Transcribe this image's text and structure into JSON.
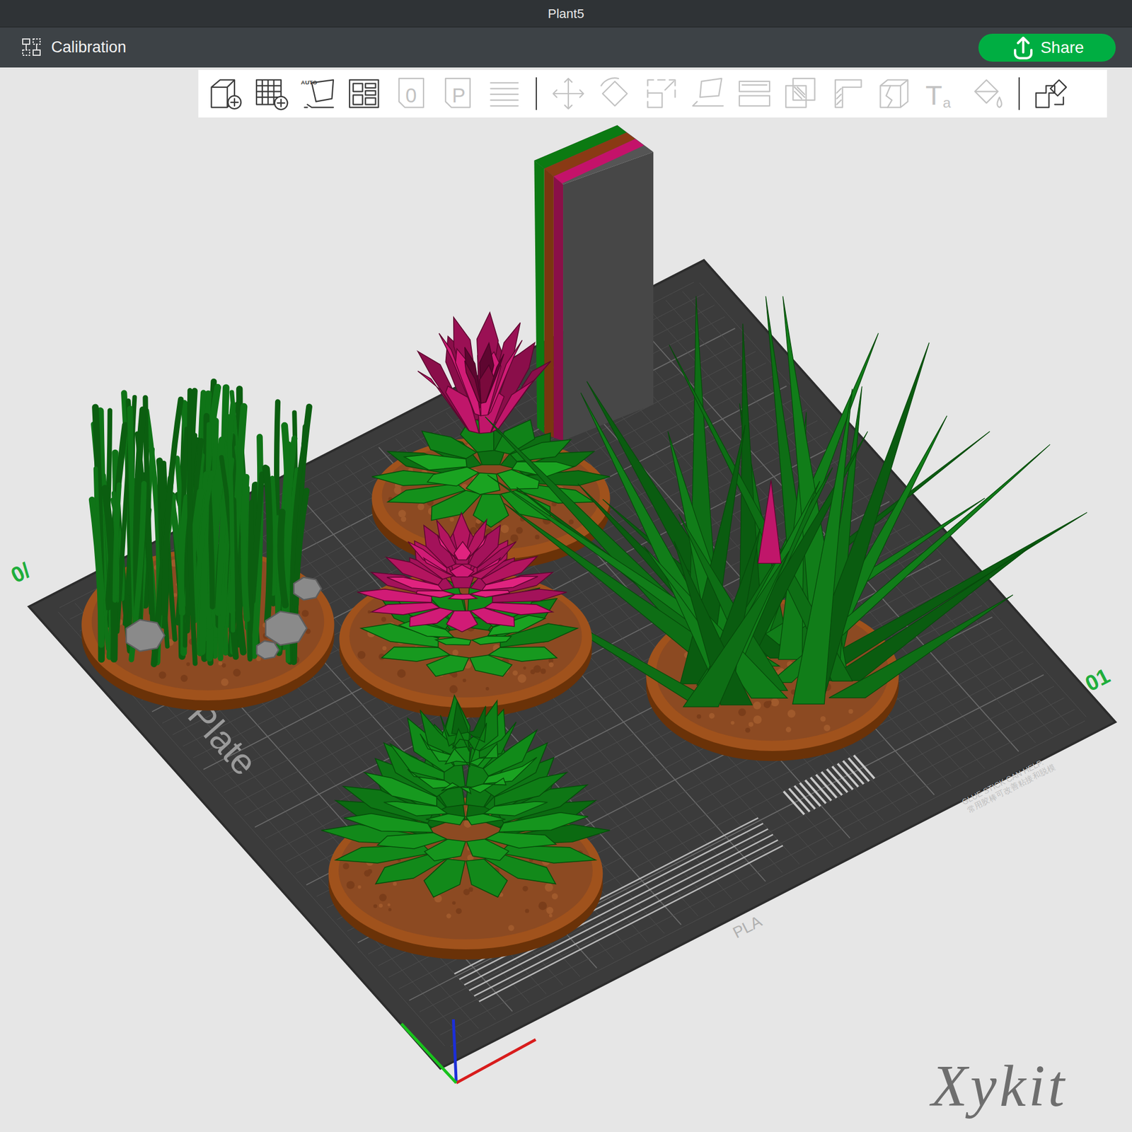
{
  "window": {
    "title": "Plant5"
  },
  "topbar": {
    "calibration": "Calibration",
    "share": "Share"
  },
  "toolbar": [
    {
      "kind": "add-object",
      "enabled": true
    },
    {
      "kind": "add-plate",
      "enabled": true
    },
    {
      "kind": "auto-orient",
      "text": "AUTO",
      "enabled": true
    },
    {
      "kind": "arrange",
      "enabled": true
    },
    {
      "kind": "plate-number",
      "text": "0",
      "enabled": false
    },
    {
      "kind": "plate-letter",
      "text": "P",
      "enabled": false
    },
    {
      "kind": "layers",
      "enabled": false
    },
    {
      "kind": "separator",
      "enabled": true
    },
    {
      "kind": "move",
      "enabled": false
    },
    {
      "kind": "rotate",
      "enabled": false
    },
    {
      "kind": "scale",
      "enabled": false
    },
    {
      "kind": "lay-flat",
      "enabled": false
    },
    {
      "kind": "split",
      "enabled": false
    },
    {
      "kind": "boolean",
      "enabled": false
    },
    {
      "kind": "support",
      "enabled": false
    },
    {
      "kind": "cut",
      "enabled": false
    },
    {
      "kind": "text",
      "text": "T",
      "subtext": "a",
      "enabled": false
    },
    {
      "kind": "paint",
      "enabled": false
    },
    {
      "kind": "separator",
      "enabled": true
    },
    {
      "kind": "assembly",
      "enabled": true
    }
  ],
  "plate": {
    "name": "Cool Plate",
    "filament": "PLA",
    "note": "GLUE STICK CAN HELP.",
    "note_cn": "常用胶棒可改善粘接和脱模",
    "number": "01",
    "origin_label": "0/"
  },
  "watermark": "Xykit"
}
